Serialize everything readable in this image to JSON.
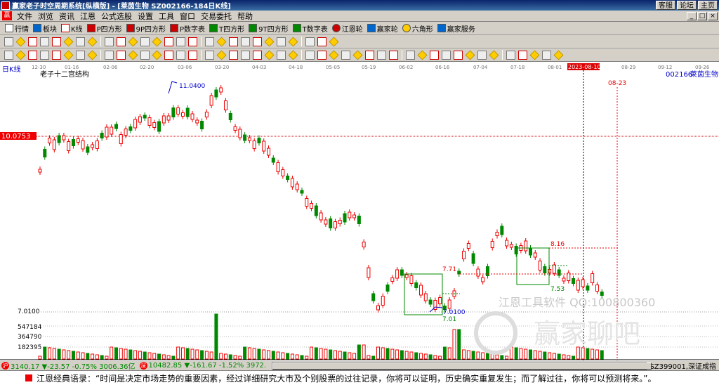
{
  "window": {
    "title": "赢家老子时空周期系统[纵横版] - [莱茵生物 SZ002166-184日K线]",
    "right_buttons": [
      "客服",
      "论坛",
      "主页"
    ],
    "win_controls": [
      "_",
      "□",
      "×"
    ]
  },
  "menu": [
    "文件",
    "浏览",
    "资讯",
    "江恩",
    "公式选股",
    "设置",
    "工具",
    "窗口",
    "交易委托",
    "帮助"
  ],
  "toolbar1": [
    "行情",
    "板块",
    "K线",
    "P四方形",
    "9P四方形",
    "P数字表",
    "T四方形",
    "9T四方形",
    "T数字表",
    "江恩轮",
    "赢家轮",
    "六角形",
    "赢家服务"
  ],
  "chart": {
    "period_label": "日K线",
    "chart_title": "老子十二宫结构",
    "stock_code": "002166",
    "stock_name": "莱茵生物",
    "cursor_date": "2023-08-10",
    "future_date": "08-23",
    "current_price_tag": "10.0753",
    "low_axis_label": "7.0100",
    "vol_labels": [
      "547184",
      "364790",
      "182395"
    ],
    "high_label": "11.0400",
    "low_label": "7.01",
    "low_label2": "7.0100",
    "box_labels": [
      "8.16",
      "7.71",
      "7.53"
    ],
    "dates": [
      "12-30",
      "01-16",
      "02-06",
      "02-20",
      "03-06",
      "03-20",
      "04-03",
      "04-18",
      "05-05",
      "05-19",
      "06-02",
      "06-16",
      "07-04",
      "07-18",
      "08-01",
      "2023-08-10",
      "08-29",
      "09-12",
      "09-26"
    ],
    "watermark1": "江恩工具软件  QQ:100800360",
    "watermark2": "赢家聊吧"
  },
  "status": {
    "sh_index": "3140.17 ▼-23.57 -0.75% 3006.36亿",
    "sz_index": "10482.85 ▼-161.67 -1.52% 3972.",
    "sz_ticker": "SZ399001,深证成指"
  },
  "tip": "江恩经典语录：“时间是决定市场走势的重要因素，经过详细研究大市及个别股票的过往记录，你将可以证明，历史确实重复发生；而了解过往，你将可以预测将来。”。",
  "chart_data": {
    "type": "candlestick",
    "title": "老子十二宫结构",
    "stock": "002166 莱茵生物",
    "series": [
      {
        "name": "price",
        "ohlc_approx": [
          [
            9.6,
            9.8,
            9.4,
            9.5
          ],
          [
            9.8,
            10.3,
            9.7,
            10.2
          ],
          [
            10.1,
            10.4,
            9.9,
            10.0
          ],
          [
            10.2,
            10.5,
            10.0,
            10.4
          ],
          [
            10.3,
            10.6,
            10.1,
            10.2
          ],
          [
            10.0,
            10.3,
            9.8,
            9.9
          ],
          [
            10.4,
            10.9,
            10.3,
            10.8
          ],
          [
            10.6,
            11.04,
            10.5,
            10.9
          ],
          [
            10.5,
            10.7,
            10.2,
            10.3
          ],
          [
            10.2,
            10.4,
            10.0,
            10.1
          ],
          [
            10.3,
            10.5,
            10.1,
            10.4
          ],
          [
            10.0,
            10.2,
            9.6,
            9.7
          ],
          [
            9.5,
            9.7,
            9.2,
            9.3
          ],
          [
            9.3,
            9.4,
            8.8,
            8.9
          ],
          [
            8.7,
            8.9,
            8.4,
            8.5
          ],
          [
            8.6,
            8.8,
            8.3,
            8.7
          ],
          [
            7.3,
            7.6,
            7.1,
            7.5
          ],
          [
            7.6,
            8.0,
            7.5,
            7.9
          ],
          [
            7.8,
            7.9,
            7.4,
            7.5
          ],
          [
            7.4,
            7.5,
            7.1,
            7.2
          ],
          [
            7.6,
            8.2,
            7.5,
            8.1
          ],
          [
            8.4,
            8.6,
            8.1,
            8.2
          ],
          [
            8.2,
            8.3,
            7.9,
            8.0
          ],
          [
            7.9,
            8.0,
            7.6,
            7.7
          ],
          [
            7.6,
            7.8,
            7.5,
            7.7
          ]
        ]
      }
    ],
    "y_ticks": [
      "10.0753",
      "7.0100"
    ],
    "volume_ticks": [
      "547184",
      "364790",
      "182395"
    ],
    "x_ticks": [
      "12-30",
      "01-16",
      "02-06",
      "02-20",
      "03-06",
      "03-20",
      "04-03",
      "04-18",
      "05-05",
      "05-19",
      "06-02",
      "06-16",
      "07-04",
      "07-18",
      "08-01",
      "2023-08-10",
      "08-29",
      "09-12",
      "09-26"
    ]
  }
}
